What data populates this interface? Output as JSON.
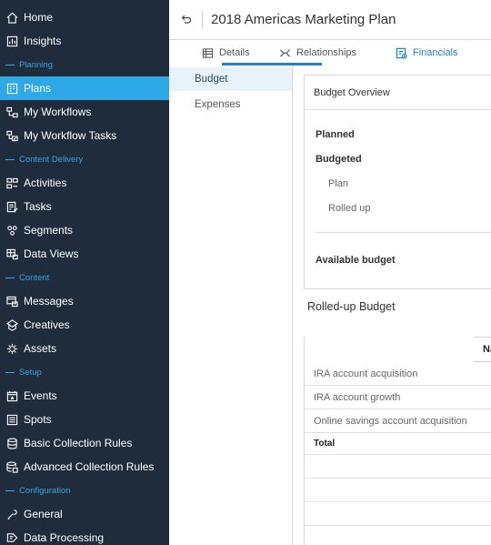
{
  "sidebar": {
    "items": [
      {
        "label": "Home",
        "icon": "home-icon",
        "type": "item"
      },
      {
        "label": "Insights",
        "icon": "insights-icon",
        "type": "item"
      },
      {
        "label": "Planning",
        "type": "section"
      },
      {
        "label": "Plans",
        "icon": "plans-icon",
        "type": "item",
        "active": true
      },
      {
        "label": "My Workflows",
        "icon": "workflows-icon",
        "type": "item"
      },
      {
        "label": "My Workflow Tasks",
        "icon": "workflow-tasks-icon",
        "type": "item"
      },
      {
        "label": "Content Delivery",
        "type": "section"
      },
      {
        "label": "Activities",
        "icon": "activities-icon",
        "type": "item"
      },
      {
        "label": "Tasks",
        "icon": "tasks-icon",
        "type": "item"
      },
      {
        "label": "Segments",
        "icon": "segments-icon",
        "type": "item"
      },
      {
        "label": "Data Views",
        "icon": "data-views-icon",
        "type": "item"
      },
      {
        "label": "Content",
        "type": "section"
      },
      {
        "label": "Messages",
        "icon": "messages-icon",
        "type": "item"
      },
      {
        "label": "Creatives",
        "icon": "creatives-icon",
        "type": "item"
      },
      {
        "label": "Assets",
        "icon": "assets-icon",
        "type": "item"
      },
      {
        "label": "Setup",
        "type": "section"
      },
      {
        "label": "Events",
        "icon": "events-icon",
        "type": "item"
      },
      {
        "label": "Spots",
        "icon": "spots-icon",
        "type": "item"
      },
      {
        "label": "Basic Collection Rules",
        "icon": "basic-rules-icon",
        "type": "item"
      },
      {
        "label": "Advanced Collection Rules",
        "icon": "advanced-rules-icon",
        "type": "item"
      },
      {
        "label": "Configuration",
        "type": "section"
      },
      {
        "label": "General",
        "icon": "general-icon",
        "type": "item"
      },
      {
        "label": "Data Processing",
        "icon": "data-processing-icon",
        "type": "item"
      }
    ]
  },
  "header": {
    "title": "2018 Americas Marketing Plan",
    "back_icon": "back-icon"
  },
  "tabs": [
    {
      "label": "Details",
      "icon": "details-icon"
    },
    {
      "label": "Relationships",
      "icon": "relationships-icon"
    },
    {
      "label": "Financials",
      "icon": "financials-icon",
      "active": true
    }
  ],
  "subnav": {
    "items": [
      {
        "label": "Budget",
        "active": true
      },
      {
        "label": "Expenses"
      }
    ]
  },
  "overview": {
    "title": "Budget Overview",
    "planned": "Planned",
    "budgeted": "Budgeted",
    "plan": "Plan",
    "rolled_up": "Rolled up",
    "available": "Available budget"
  },
  "rolled_up": {
    "title": "Rolled-up Budget",
    "column_name": "Name",
    "rows": [
      "IRA account acquisition",
      "IRA account growth",
      "Online savings account acquisition"
    ],
    "total": "Total"
  },
  "colors": {
    "sidebar_bg": "#1f2c3b",
    "active_nav": "#2fa8e8",
    "section_label": "#3aa4e4",
    "accent": "#1f84cf"
  }
}
